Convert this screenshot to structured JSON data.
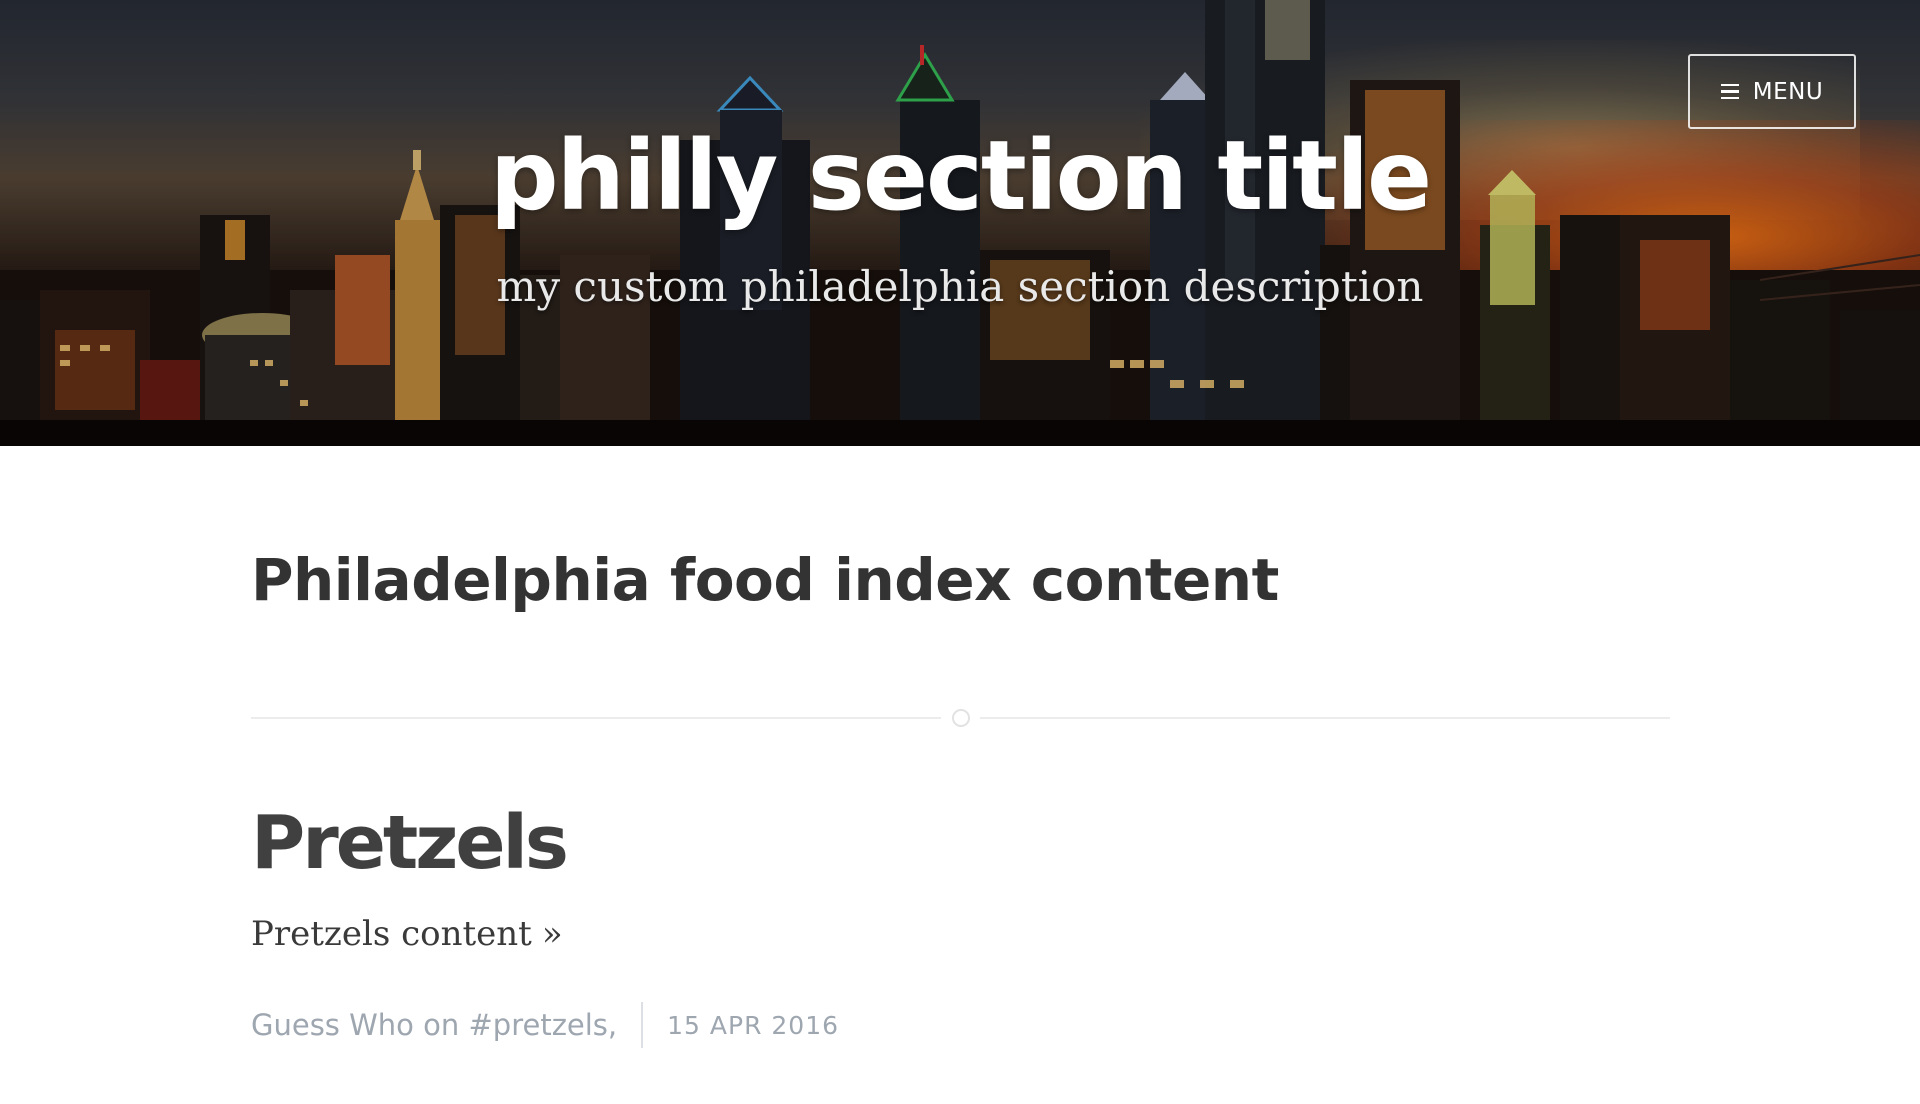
{
  "header": {
    "menu_label": "MENU",
    "site_title": "philly section title",
    "site_description": "my custom philadelphia section description"
  },
  "main": {
    "page_heading": "Philadelphia food index content",
    "posts": [
      {
        "title": "Pretzels",
        "excerpt": "Pretzels content",
        "read_more": "»",
        "meta_author": "Guess Who on #pretzels,",
        "meta_date": "15 APR 2016"
      }
    ]
  },
  "icons": {
    "menu": "hamburger-icon",
    "divider": "circle-icon"
  },
  "colors": {
    "heading": "#333333",
    "post_title": "#404040",
    "meta": "#9ea6b0",
    "hero_text": "#ffffff"
  }
}
